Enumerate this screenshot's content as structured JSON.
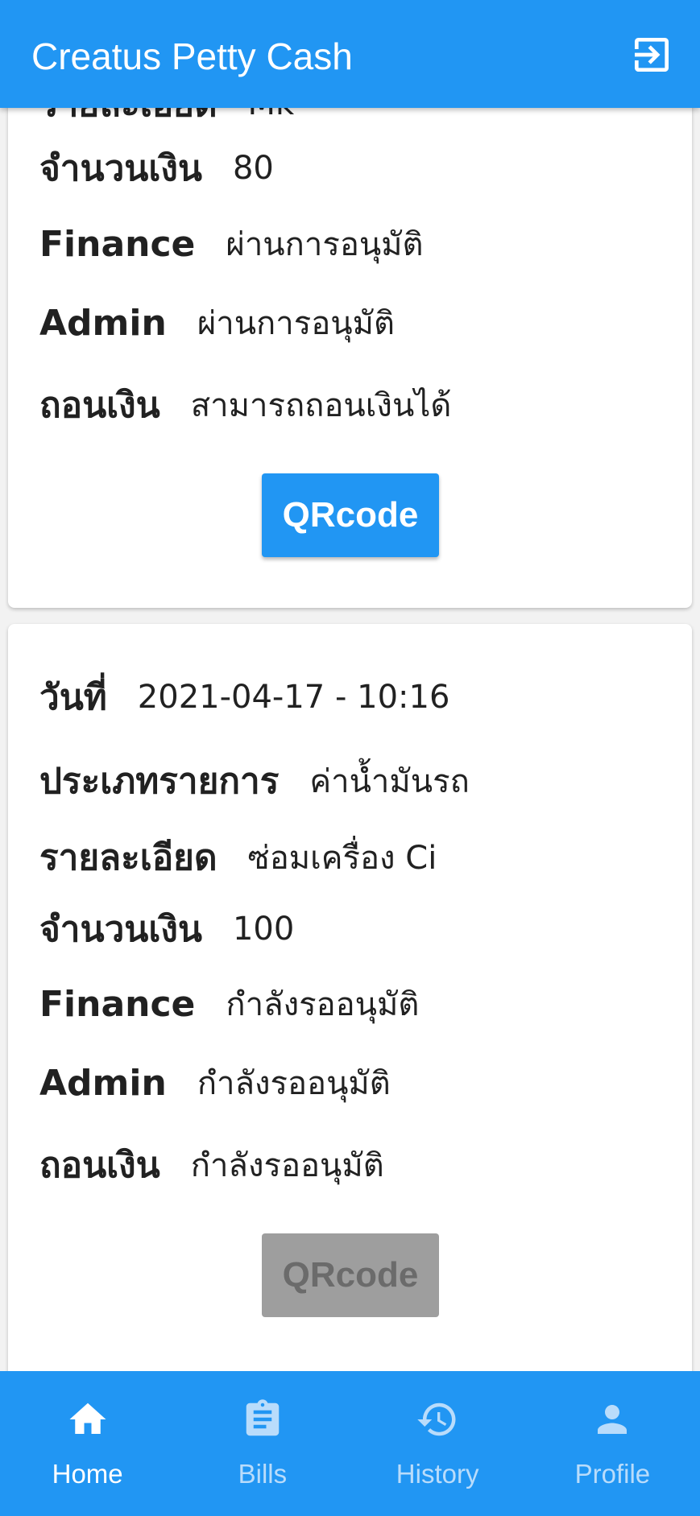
{
  "app_bar": {
    "title": "Creatus Petty Cash",
    "logout_icon": "logout-icon"
  },
  "cards": [
    {
      "detail_label_partial": "รายละเอียด",
      "detail_value_partial": "Mk",
      "amount_label": "จำนวนเงิน",
      "amount_value": "80",
      "finance_label": "Finance",
      "finance_value": "ผ่านการอนุมัติ",
      "admin_label": "Admin",
      "admin_value": "ผ่านการอนุมัติ",
      "withdraw_label": "ถอนเงิน",
      "withdraw_value": "สามารถถอนเงินได้",
      "qr_label": "QRcode",
      "qr_enabled": true
    },
    {
      "date_label": "วันที่",
      "date_value": "2021-04-17 - 10:16",
      "type_label": "ประเภทรายการ",
      "type_value": "ค่าน้ำมันรถ",
      "detail_label": "รายละเอียด",
      "detail_value": "ซ่อมเครื่อง Ci",
      "amount_label": "จำนวนเงิน",
      "amount_value": "100",
      "finance_label": "Finance",
      "finance_value": "กำลังรออนุมัติ",
      "admin_label": "Admin",
      "admin_value": "กำลังรออนุมัติ",
      "withdraw_label": "ถอนเงิน",
      "withdraw_value": "กำลังรออนุมัติ",
      "qr_label": "QRcode",
      "qr_enabled": false
    }
  ],
  "bottom_nav": {
    "active": "Home",
    "items": [
      {
        "label": "Home",
        "icon": "home-icon"
      },
      {
        "label": "Bills",
        "icon": "clipboard-icon"
      },
      {
        "label": "History",
        "icon": "history-icon"
      },
      {
        "label": "Profile",
        "icon": "person-icon"
      }
    ]
  },
  "colors": {
    "primary": "#2196f3",
    "disabled_button": "#9e9e9e",
    "inactive_nav_label": "#b9dcfb"
  }
}
